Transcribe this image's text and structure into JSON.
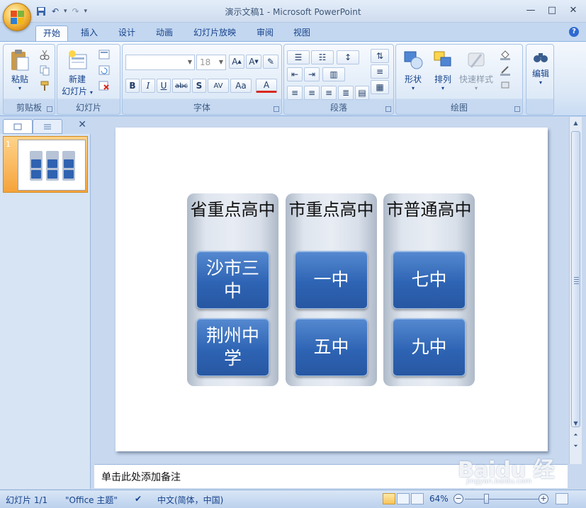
{
  "window": {
    "title": "演示文稿1 - Microsoft PowerPoint",
    "controls": [
      "—",
      "□",
      "✕"
    ]
  },
  "qat": {
    "undo": "↶",
    "redo": "↷",
    "save_icon": "save-icon",
    "customize": "▾"
  },
  "tabs": [
    {
      "label": "开始"
    },
    {
      "label": "插入"
    },
    {
      "label": "设计"
    },
    {
      "label": "动画"
    },
    {
      "label": "幻灯片放映"
    },
    {
      "label": "审阅"
    },
    {
      "label": "视图"
    }
  ],
  "ribbon": {
    "clipboard": {
      "label": "剪贴板",
      "paste": "粘贴"
    },
    "slides": {
      "label": "幻灯片",
      "new_slide": "新建",
      "new_slide_2": "幻灯片"
    },
    "font": {
      "label": "字体",
      "font_size": "18",
      "bold": "B",
      "italic": "I",
      "underline": "U",
      "strike": "abc",
      "shadow": "S",
      "spacing": "AV",
      "case": "Aa",
      "color": "A"
    },
    "paragraph": {
      "label": "段落"
    },
    "drawing": {
      "label": "绘图",
      "shapes": "形状",
      "arrange": "排列",
      "quick_styles": "快速样式"
    },
    "editing": {
      "label": "编辑"
    }
  },
  "side_panel": {
    "slide_number": "1",
    "close": "✕"
  },
  "slide": {
    "columns": [
      {
        "title": "省重点高中",
        "items": [
          "沙市三中",
          "荆州中学"
        ]
      },
      {
        "title": "市重点高中",
        "items": [
          "一中",
          "五中"
        ]
      },
      {
        "title": "市普通高中",
        "items": [
          "七中",
          "九中"
        ]
      }
    ]
  },
  "notes": {
    "placeholder": "单击此处添加备注"
  },
  "watermark": {
    "text": "Baidu 经验",
    "sub": "jingyan.baidu.com"
  },
  "status": {
    "slide_info": "幻灯片 1/1",
    "theme": "\"Office 主题\"",
    "language": "中文(简体，中国)",
    "zoom": "64%"
  },
  "colors": {
    "accent": "#2e64b4",
    "ribbon_bg": "#dbe7f6",
    "selected_thumb": "#f5a33b"
  }
}
